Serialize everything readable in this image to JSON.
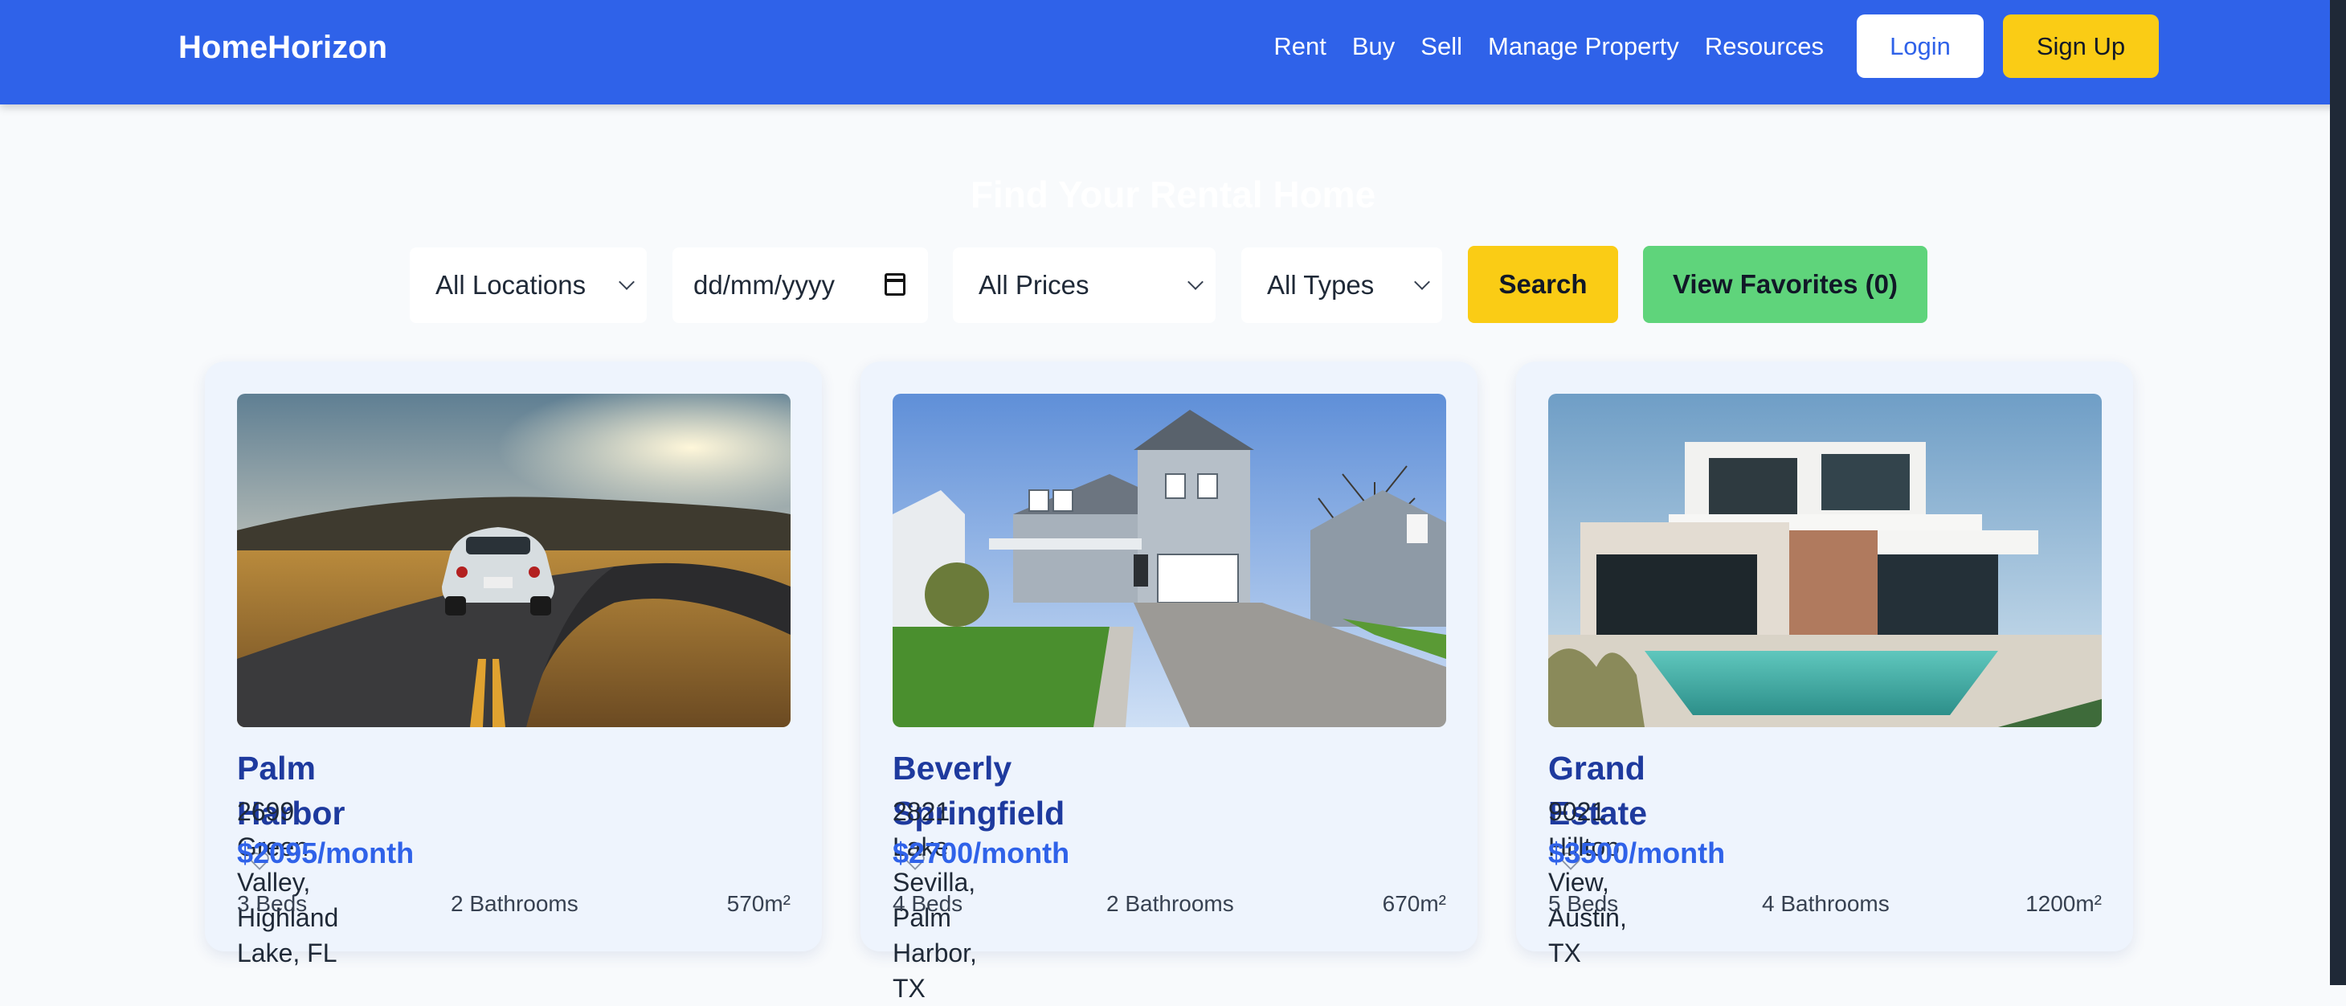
{
  "header": {
    "logo": "HomeHorizon",
    "nav": [
      "Rent",
      "Buy",
      "Sell",
      "Manage Property",
      "Resources"
    ],
    "login_label": "Login",
    "signup_label": "Sign Up"
  },
  "hero": {
    "title": "Find Your Rental Home"
  },
  "filters": {
    "location": "All Locations",
    "date_placeholder": "dd/mm/yyyy",
    "price": "All Prices",
    "type": "All Types",
    "search_label": "Search",
    "favorites_label": "View Favorites (0)"
  },
  "listings": [
    {
      "name": "Palm Harbor",
      "address": "2699 Green Valley, Highland Lake, FL",
      "price": "$2095/month",
      "beds": "3 Beds",
      "baths": "2 Bathrooms",
      "area": "570m²"
    },
    {
      "name": "Beverly Springfield",
      "address": "2821 Lake Sevilla, Palm Harbor, TX",
      "price": "$2700/month",
      "beds": "4 Beds",
      "baths": "2 Bathrooms",
      "area": "670m²"
    },
    {
      "name": "Grand Estate",
      "address": "9021 Hilltop View, Austin, TX",
      "price": "$3500/month",
      "beds": "5 Beds",
      "baths": "4 Bathrooms",
      "area": "1200m²"
    }
  ],
  "colors": {
    "header_bg": "#2f62e9",
    "accent_yellow": "#facc15",
    "favorites_green": "#5fd47b",
    "title_blue": "#1e3a9e"
  },
  "icons": [
    "heart-icon",
    "chevron-down-icon",
    "calendar-icon"
  ]
}
